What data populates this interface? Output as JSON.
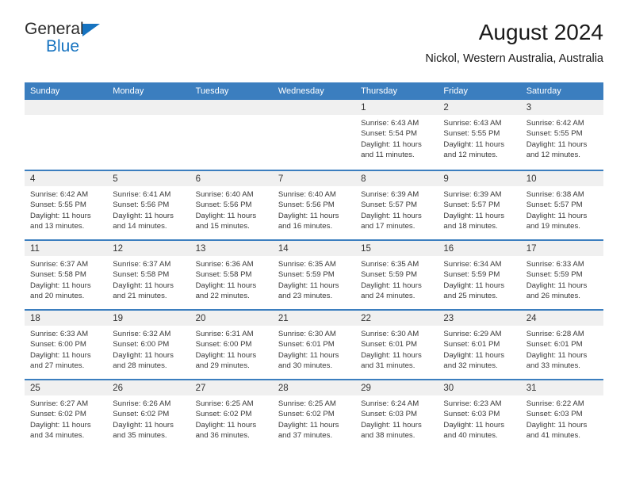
{
  "brand": {
    "name_part1": "General",
    "name_part2": "Blue",
    "triangle_color": "#1673c0"
  },
  "header": {
    "title": "August 2024",
    "subtitle": "Nickol, Western Australia, Australia"
  },
  "theme": {
    "header_blue": "#3b7ebf",
    "daynum_band": "#f0f0f0",
    "text": "#3a3a3a"
  },
  "calendar": {
    "weekday_headers": [
      "Sunday",
      "Monday",
      "Tuesday",
      "Wednesday",
      "Thursday",
      "Friday",
      "Saturday"
    ],
    "weeks": [
      [
        {
          "day": "",
          "sunrise": "",
          "sunset": "",
          "daylight1": "",
          "daylight2": ""
        },
        {
          "day": "",
          "sunrise": "",
          "sunset": "",
          "daylight1": "",
          "daylight2": ""
        },
        {
          "day": "",
          "sunrise": "",
          "sunset": "",
          "daylight1": "",
          "daylight2": ""
        },
        {
          "day": "",
          "sunrise": "",
          "sunset": "",
          "daylight1": "",
          "daylight2": ""
        },
        {
          "day": "1",
          "sunrise": "Sunrise: 6:43 AM",
          "sunset": "Sunset: 5:54 PM",
          "daylight1": "Daylight: 11 hours",
          "daylight2": "and 11 minutes."
        },
        {
          "day": "2",
          "sunrise": "Sunrise: 6:43 AM",
          "sunset": "Sunset: 5:55 PM",
          "daylight1": "Daylight: 11 hours",
          "daylight2": "and 12 minutes."
        },
        {
          "day": "3",
          "sunrise": "Sunrise: 6:42 AM",
          "sunset": "Sunset: 5:55 PM",
          "daylight1": "Daylight: 11 hours",
          "daylight2": "and 12 minutes."
        }
      ],
      [
        {
          "day": "4",
          "sunrise": "Sunrise: 6:42 AM",
          "sunset": "Sunset: 5:55 PM",
          "daylight1": "Daylight: 11 hours",
          "daylight2": "and 13 minutes."
        },
        {
          "day": "5",
          "sunrise": "Sunrise: 6:41 AM",
          "sunset": "Sunset: 5:56 PM",
          "daylight1": "Daylight: 11 hours",
          "daylight2": "and 14 minutes."
        },
        {
          "day": "6",
          "sunrise": "Sunrise: 6:40 AM",
          "sunset": "Sunset: 5:56 PM",
          "daylight1": "Daylight: 11 hours",
          "daylight2": "and 15 minutes."
        },
        {
          "day": "7",
          "sunrise": "Sunrise: 6:40 AM",
          "sunset": "Sunset: 5:56 PM",
          "daylight1": "Daylight: 11 hours",
          "daylight2": "and 16 minutes."
        },
        {
          "day": "8",
          "sunrise": "Sunrise: 6:39 AM",
          "sunset": "Sunset: 5:57 PM",
          "daylight1": "Daylight: 11 hours",
          "daylight2": "and 17 minutes."
        },
        {
          "day": "9",
          "sunrise": "Sunrise: 6:39 AM",
          "sunset": "Sunset: 5:57 PM",
          "daylight1": "Daylight: 11 hours",
          "daylight2": "and 18 minutes."
        },
        {
          "day": "10",
          "sunrise": "Sunrise: 6:38 AM",
          "sunset": "Sunset: 5:57 PM",
          "daylight1": "Daylight: 11 hours",
          "daylight2": "and 19 minutes."
        }
      ],
      [
        {
          "day": "11",
          "sunrise": "Sunrise: 6:37 AM",
          "sunset": "Sunset: 5:58 PM",
          "daylight1": "Daylight: 11 hours",
          "daylight2": "and 20 minutes."
        },
        {
          "day": "12",
          "sunrise": "Sunrise: 6:37 AM",
          "sunset": "Sunset: 5:58 PM",
          "daylight1": "Daylight: 11 hours",
          "daylight2": "and 21 minutes."
        },
        {
          "day": "13",
          "sunrise": "Sunrise: 6:36 AM",
          "sunset": "Sunset: 5:58 PM",
          "daylight1": "Daylight: 11 hours",
          "daylight2": "and 22 minutes."
        },
        {
          "day": "14",
          "sunrise": "Sunrise: 6:35 AM",
          "sunset": "Sunset: 5:59 PM",
          "daylight1": "Daylight: 11 hours",
          "daylight2": "and 23 minutes."
        },
        {
          "day": "15",
          "sunrise": "Sunrise: 6:35 AM",
          "sunset": "Sunset: 5:59 PM",
          "daylight1": "Daylight: 11 hours",
          "daylight2": "and 24 minutes."
        },
        {
          "day": "16",
          "sunrise": "Sunrise: 6:34 AM",
          "sunset": "Sunset: 5:59 PM",
          "daylight1": "Daylight: 11 hours",
          "daylight2": "and 25 minutes."
        },
        {
          "day": "17",
          "sunrise": "Sunrise: 6:33 AM",
          "sunset": "Sunset: 5:59 PM",
          "daylight1": "Daylight: 11 hours",
          "daylight2": "and 26 minutes."
        }
      ],
      [
        {
          "day": "18",
          "sunrise": "Sunrise: 6:33 AM",
          "sunset": "Sunset: 6:00 PM",
          "daylight1": "Daylight: 11 hours",
          "daylight2": "and 27 minutes."
        },
        {
          "day": "19",
          "sunrise": "Sunrise: 6:32 AM",
          "sunset": "Sunset: 6:00 PM",
          "daylight1": "Daylight: 11 hours",
          "daylight2": "and 28 minutes."
        },
        {
          "day": "20",
          "sunrise": "Sunrise: 6:31 AM",
          "sunset": "Sunset: 6:00 PM",
          "daylight1": "Daylight: 11 hours",
          "daylight2": "and 29 minutes."
        },
        {
          "day": "21",
          "sunrise": "Sunrise: 6:30 AM",
          "sunset": "Sunset: 6:01 PM",
          "daylight1": "Daylight: 11 hours",
          "daylight2": "and 30 minutes."
        },
        {
          "day": "22",
          "sunrise": "Sunrise: 6:30 AM",
          "sunset": "Sunset: 6:01 PM",
          "daylight1": "Daylight: 11 hours",
          "daylight2": "and 31 minutes."
        },
        {
          "day": "23",
          "sunrise": "Sunrise: 6:29 AM",
          "sunset": "Sunset: 6:01 PM",
          "daylight1": "Daylight: 11 hours",
          "daylight2": "and 32 minutes."
        },
        {
          "day": "24",
          "sunrise": "Sunrise: 6:28 AM",
          "sunset": "Sunset: 6:01 PM",
          "daylight1": "Daylight: 11 hours",
          "daylight2": "and 33 minutes."
        }
      ],
      [
        {
          "day": "25",
          "sunrise": "Sunrise: 6:27 AM",
          "sunset": "Sunset: 6:02 PM",
          "daylight1": "Daylight: 11 hours",
          "daylight2": "and 34 minutes."
        },
        {
          "day": "26",
          "sunrise": "Sunrise: 6:26 AM",
          "sunset": "Sunset: 6:02 PM",
          "daylight1": "Daylight: 11 hours",
          "daylight2": "and 35 minutes."
        },
        {
          "day": "27",
          "sunrise": "Sunrise: 6:25 AM",
          "sunset": "Sunset: 6:02 PM",
          "daylight1": "Daylight: 11 hours",
          "daylight2": "and 36 minutes."
        },
        {
          "day": "28",
          "sunrise": "Sunrise: 6:25 AM",
          "sunset": "Sunset: 6:02 PM",
          "daylight1": "Daylight: 11 hours",
          "daylight2": "and 37 minutes."
        },
        {
          "day": "29",
          "sunrise": "Sunrise: 6:24 AM",
          "sunset": "Sunset: 6:03 PM",
          "daylight1": "Daylight: 11 hours",
          "daylight2": "and 38 minutes."
        },
        {
          "day": "30",
          "sunrise": "Sunrise: 6:23 AM",
          "sunset": "Sunset: 6:03 PM",
          "daylight1": "Daylight: 11 hours",
          "daylight2": "and 40 minutes."
        },
        {
          "day": "31",
          "sunrise": "Sunrise: 6:22 AM",
          "sunset": "Sunset: 6:03 PM",
          "daylight1": "Daylight: 11 hours",
          "daylight2": "and 41 minutes."
        }
      ]
    ]
  }
}
